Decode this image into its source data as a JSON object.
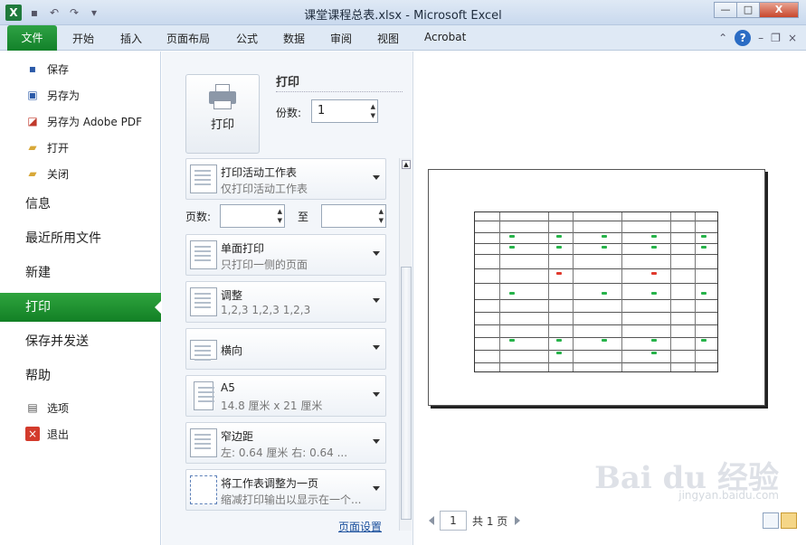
{
  "window": {
    "title": "课堂课程总表.xlsx - Microsoft Excel",
    "logo": "X",
    "min": "—",
    "max": "□",
    "close": "X"
  },
  "ribbon": {
    "file_tab": "文件",
    "tabs": [
      "开始",
      "插入",
      "页面布局",
      "公式",
      "数据",
      "审阅",
      "视图",
      "Acrobat"
    ],
    "help": "?"
  },
  "backstage": {
    "small_items_top": [
      {
        "label": "保存",
        "icon": "save-icon"
      },
      {
        "label": "另存为",
        "icon": "save-as-icon"
      },
      {
        "label": "另存为 Adobe PDF",
        "icon": "pdf-icon"
      },
      {
        "label": "打开",
        "icon": "open-folder-icon"
      },
      {
        "label": "关闭",
        "icon": "close-folder-icon"
      }
    ],
    "big_items": [
      "信息",
      "最近所用文件",
      "新建",
      "打印",
      "保存并发送",
      "帮助"
    ],
    "active": "打印",
    "small_items_bottom": [
      {
        "label": "选项",
        "icon": "options-icon"
      },
      {
        "label": "退出",
        "icon": "exit-icon"
      }
    ]
  },
  "print": {
    "button_label": "打印",
    "section_title": "打印",
    "copies_label": "份数:",
    "copies_value": "1",
    "pages_label": "页数:",
    "pages_to": "至",
    "page_setup": "页面设置",
    "settings": [
      {
        "title": "打印活动工作表",
        "subtitle": "仅打印活动工作表"
      },
      {
        "title": "单面打印",
        "subtitle": "只打印一侧的页面"
      },
      {
        "title": "调整",
        "subtitle": "1,2,3    1,2,3    1,2,3"
      },
      {
        "title": "横向",
        "subtitle": ""
      },
      {
        "title": "A5",
        "subtitle": "14.8 厘米 x 21 厘米"
      },
      {
        "title": "窄边距",
        "subtitle": "左:  0.64 厘米     右:  0.64 ..."
      },
      {
        "title": "将工作表调整为一页",
        "subtitle": "缩减打印输出以显示在一个..."
      }
    ]
  },
  "preview": {
    "page_current": "1",
    "page_total": "共 1 页",
    "watermark": "Bai du 经验",
    "watermark_url": "jingyan.baidu.com"
  }
}
